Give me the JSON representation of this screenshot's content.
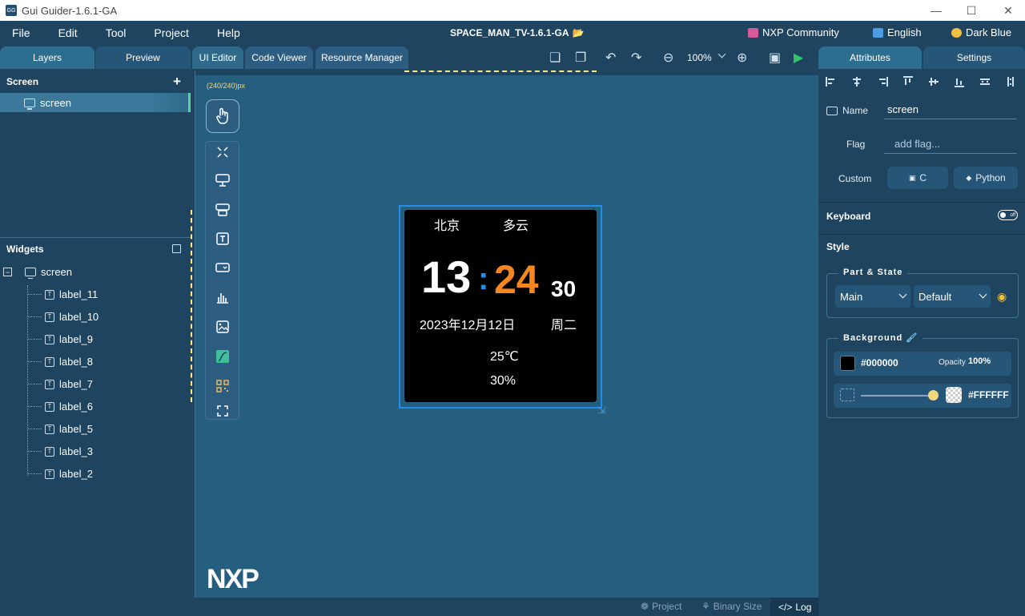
{
  "window": {
    "title": "Gui Guider-1.6.1-GA",
    "app_icon_text": "GG"
  },
  "menu": {
    "items": [
      "File",
      "Edit",
      "Tool",
      "Project",
      "Help"
    ],
    "project_title": "SPACE_MAN_TV-1.6.1-GA",
    "community": "NXP Community",
    "language": "English",
    "theme": "Dark Blue"
  },
  "left_panel": {
    "tabs": [
      "Layers",
      "Preview"
    ],
    "screen_section": "Screen",
    "screen_items": [
      "screen"
    ],
    "widgets_section": "Widgets",
    "widget_tree_root": "screen",
    "widget_tree": [
      "label_11",
      "label_10",
      "label_9",
      "label_8",
      "label_7",
      "label_6",
      "label_5",
      "label_3",
      "label_2"
    ]
  },
  "editor": {
    "tabs": [
      "UI Editor",
      "Code Viewer",
      "Resource Manager"
    ],
    "zoom": "100%",
    "size_label": "(240/240)px",
    "logo": "NXP"
  },
  "device": {
    "city": "北京",
    "weather": "多云",
    "hour": "13",
    "colon": ":",
    "minute": "24",
    "second": "30",
    "date": "2023年12月12日",
    "weekday": "周二",
    "temperature": "25℃",
    "humidity": "30%"
  },
  "status_bar": {
    "project": "Project",
    "binary_size": "Binary Size",
    "log": "Log"
  },
  "right_panel": {
    "tabs": [
      "Attributes",
      "Settings"
    ],
    "name_label": "Name",
    "name_value": "screen",
    "flag_label": "Flag",
    "flag_placeholder": "add flag...",
    "custom_label": "Custom",
    "custom_c": "C",
    "custom_python": "Python",
    "keyboard_label": "Keyboard",
    "keyboard_toggle": "off",
    "style_label": "Style",
    "part_state_legend": "Part & State",
    "part_value": "Main",
    "state_value": "Default",
    "background_legend": "Background",
    "bg_color": "#000000",
    "opacity_label": "Opacity",
    "opacity_value": "100%",
    "grad_color": "#FFFFFF"
  },
  "colors": {
    "accent_teal": "#5fd0a0",
    "minute_orange": "#f6861f",
    "colon_blue": "#1e90e8",
    "highlight_yellow": "#ffe780"
  }
}
